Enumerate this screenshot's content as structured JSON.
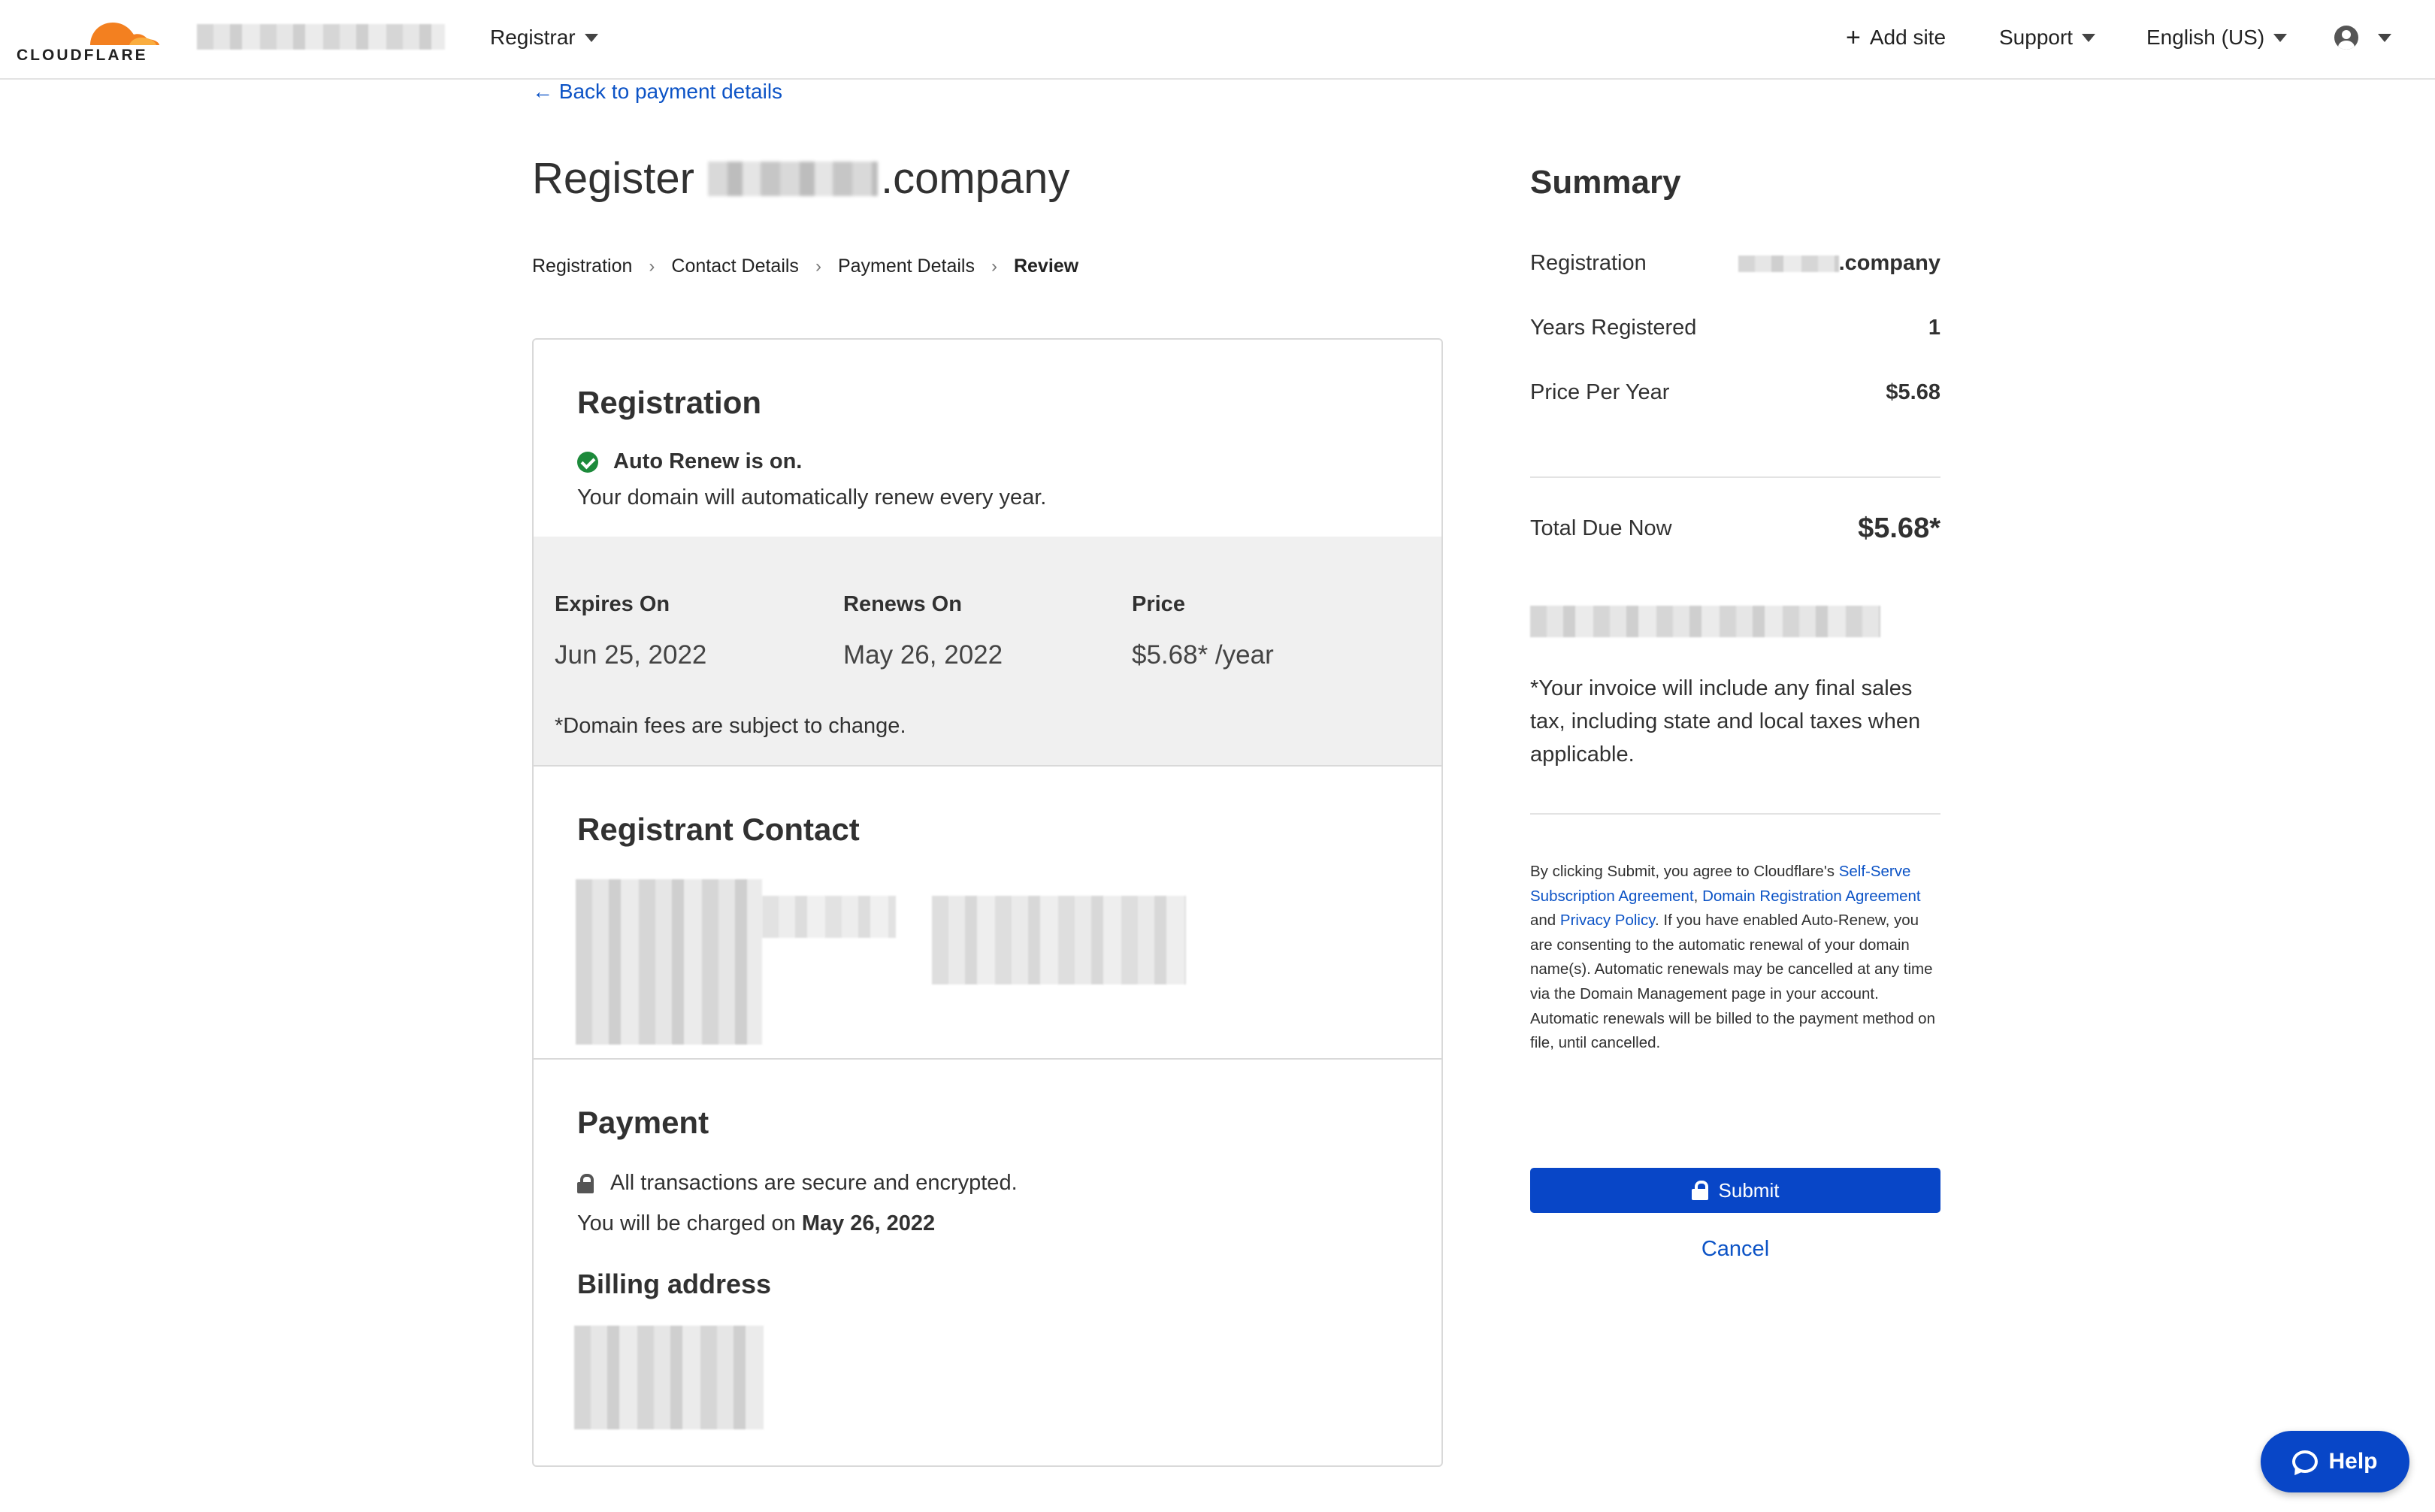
{
  "topnav": {
    "logo_text": "CLOUDFLARE",
    "product_menu": "Registrar",
    "add_site": "Add site",
    "support": "Support",
    "language": "English (US)",
    "icons": [
      "cloudflare-logo-icon",
      "plus-icon",
      "user-icon",
      "chevron-down-icon"
    ]
  },
  "back_link": "← Back to payment details",
  "page": {
    "title_prefix": "Register",
    "title_suffix": ".company"
  },
  "steps": [
    "Registration",
    "Contact Details",
    "Payment Details",
    "Review"
  ],
  "step_separator": "›",
  "registration": {
    "title": "Registration",
    "auto_renew": "Auto Renew is on.",
    "auto_renew_desc": "Your domain will automatically renew every year.",
    "expires_label": "Expires On",
    "expires_value": "Jun 25, 2022",
    "renews_label": "Renews On",
    "renews_value": "May 26, 2022",
    "price_label": "Price",
    "price_value": "$5.68* /year",
    "fee_note": "*Domain fees are subject to change."
  },
  "registrant": {
    "title": "Registrant Contact"
  },
  "payment": {
    "title": "Payment",
    "secure_text": "All transactions are secure and encrypted.",
    "charged_prefix": "You will be charged on",
    "charged_date": "May 26, 2022",
    "billing_title": "Billing address"
  },
  "summary": {
    "title": "Summary",
    "registration_label": "Registration",
    "registration_value": ".company",
    "years_label": "Years Registered",
    "years_value": "1",
    "price_label": "Price Per Year",
    "price_value": "$5.68",
    "total_label": "Total Due Now",
    "total_value": "$5.68*",
    "invoice_note": "*Your invoice will include any final sales tax, including state and local taxes when applicable.",
    "legal_1": "By clicking Submit, you agree to Cloudflare's ",
    "legal_link_1": "Self-Serve Subscription Agreement",
    "legal_2": ", ",
    "legal_link_2": "Domain Registration Agreement",
    "legal_3": " and ",
    "legal_link_3": "Privacy Policy",
    "legal_4": ". If you have enabled Auto-Renew, you are consenting to the automatic renewal of your domain name(s). Automatic renewals may be cancelled at any time via the Domain Management page in your account. Automatic renewals will be billed to the payment method on file, until cancelled.",
    "submit": "Submit",
    "cancel": "Cancel"
  },
  "help": "Help",
  "colors": {
    "accent": "#0846c7",
    "link": "#0c53c6",
    "brand_orange": "#f38020",
    "success": "#1d8a3b"
  }
}
